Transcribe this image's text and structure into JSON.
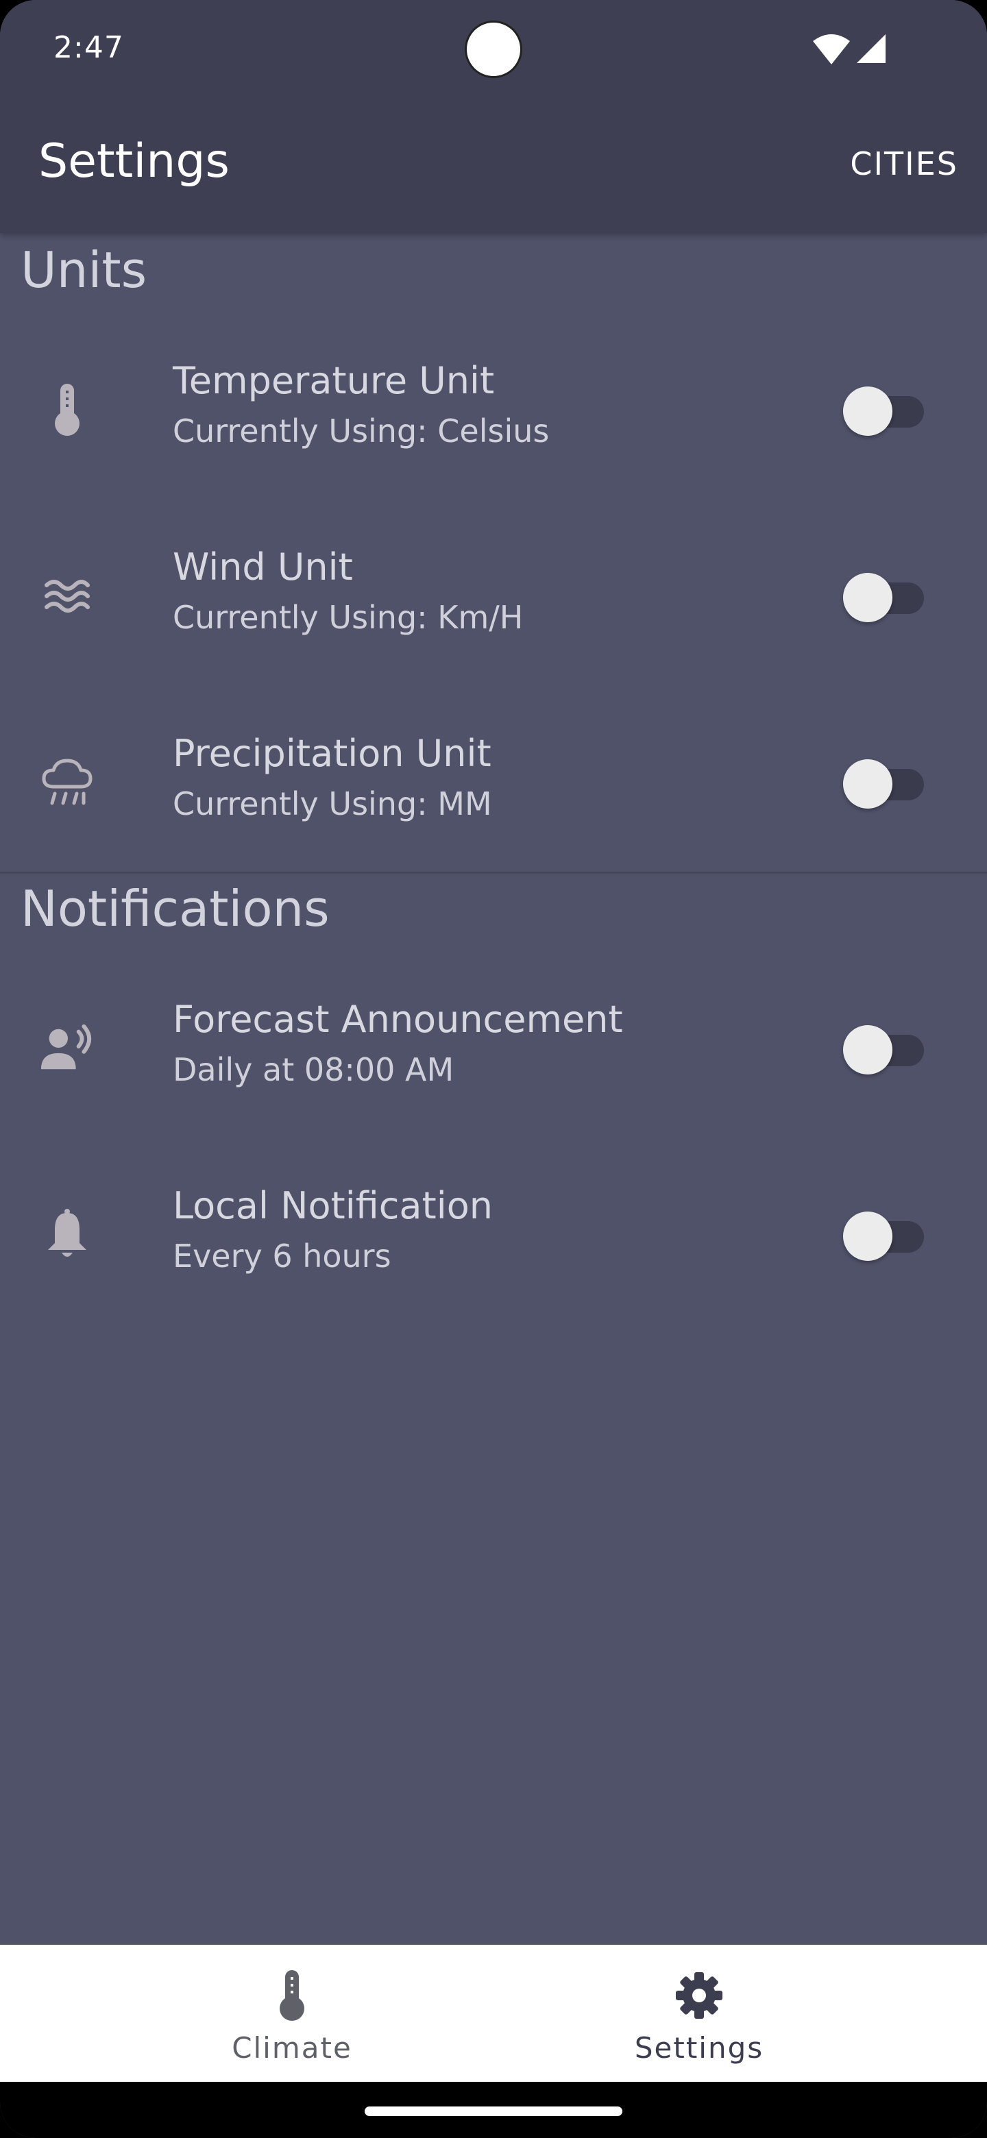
{
  "status_bar": {
    "time": "2:47"
  },
  "app_bar": {
    "title": "Settings",
    "cities_label": "CITIES"
  },
  "units": {
    "title": "Units",
    "items": [
      {
        "icon": "thermometer-icon",
        "title": "Temperature Unit",
        "subtitle": "Currently Using: Celsius",
        "enabled": false
      },
      {
        "icon": "wind-icon",
        "title": "Wind Unit",
        "subtitle": "Currently Using: Km/H",
        "enabled": false
      },
      {
        "icon": "rain-cloud-icon",
        "title": "Precipitation Unit",
        "subtitle": "Currently Using: MM",
        "enabled": false
      }
    ]
  },
  "notifications": {
    "title": "Notifications",
    "items": [
      {
        "icon": "voice-announcement-icon",
        "title": "Forecast Announcement",
        "subtitle": "Daily at 08:00 AM",
        "enabled": false
      },
      {
        "icon": "bell-icon",
        "title": "Local Notification",
        "subtitle": "Every 6 hours",
        "enabled": false
      }
    ]
  },
  "bottom_nav": {
    "items": [
      {
        "icon": "thermometer-icon",
        "label": "Climate",
        "active": false
      },
      {
        "icon": "gear-icon",
        "label": "Settings",
        "active": true
      }
    ]
  },
  "colors": {
    "header": "#3e3f52",
    "background": "#50526a",
    "icon": "#b9b4bb",
    "nav_inactive": "#5f6068",
    "nav_active": "#3c3d4e"
  }
}
